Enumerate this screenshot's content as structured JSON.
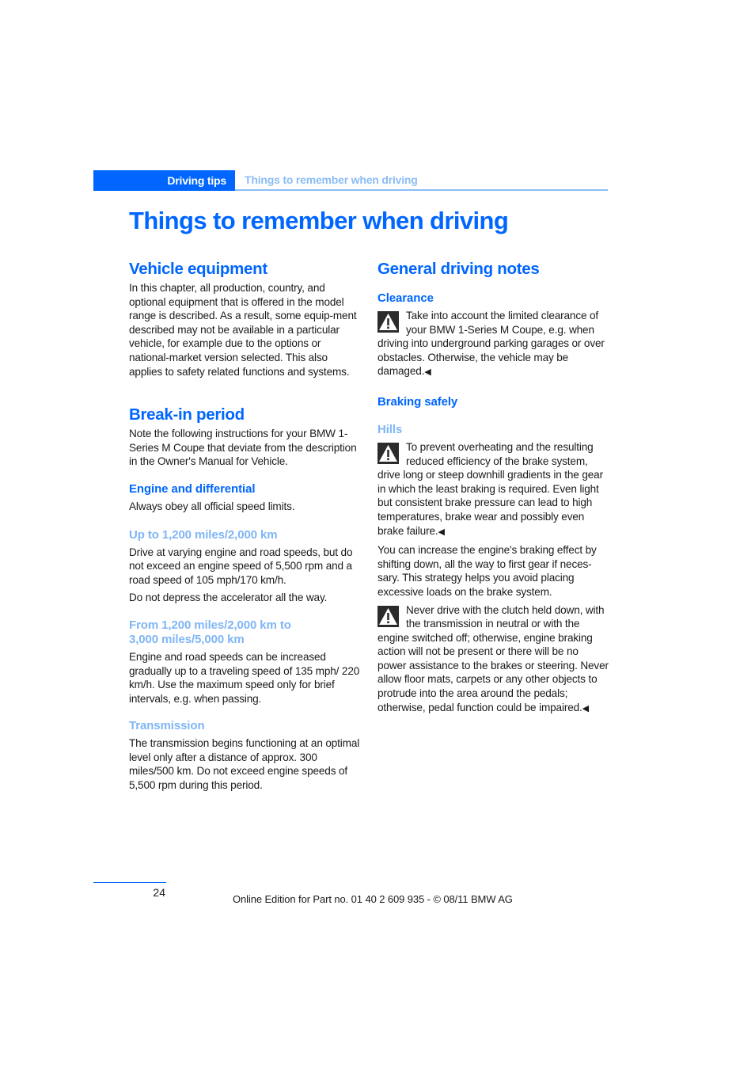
{
  "header": {
    "section": "Driving tips",
    "breadcrumb": "Things to remember when driving"
  },
  "page_title": "Things to remember when driving",
  "left_column": {
    "vehicle_equipment": {
      "heading": "Vehicle equipment",
      "body": "In this chapter, all production, country, and optional equipment that is offered in the model range is described. As a result, some equip-ment described may not be available in a particular vehicle, for example due to the options or national-market version selected. This also applies to safety related functions and systems."
    },
    "break_in": {
      "heading": "Break-in period",
      "body": "Note the following instructions for your BMW 1-Series M Coupe that deviate from the description in the Owner's Manual for Vehicle.",
      "engine": {
        "heading": "Engine and differential",
        "body": "Always obey all official speed limits."
      },
      "up_to": {
        "heading": "Up to 1,200 miles/2,000 km",
        "body1": "Drive at varying engine and road speeds, but do not exceed an engine speed of 5,500 rpm and a road speed of 105 mph/170 km/h.",
        "body2": "Do not depress the accelerator all the way."
      },
      "from": {
        "heading": "From 1,200 miles/2,000 km to 3,000 miles/5,000 km",
        "body": "Engine and road speeds can be increased gradually up to a traveling speed of 135 mph/ 220 km/h. Use the maximum speed only for brief intervals, e.g. when passing."
      },
      "transmission": {
        "heading": "Transmission",
        "body": "The transmission begins functioning at an optimal level only after a distance of approx. 300 miles/500 km. Do not exceed engine speeds of 5,500 rpm during this period."
      }
    }
  },
  "right_column": {
    "heading": "General driving notes",
    "clearance": {
      "heading": "Clearance",
      "warning": "Take into account the limited clearance of your BMW 1-Series M Coupe, e.g. when driving into underground parking garages or over obstacles. Otherwise, the vehicle may be damaged."
    },
    "braking": {
      "heading": "Braking safely",
      "hills": {
        "heading": "Hills",
        "warning": "To prevent overheating and the resulting reduced efficiency of the brake system, drive long or steep downhill gradients in the gear in which the least braking is required. Even light but consistent brake pressure can lead to high temperatures, brake wear and possibly even brake failure.",
        "body": "You can increase the engine's braking effect by shifting down, all the way to first gear if neces-sary. This strategy helps you avoid placing excessive loads on the brake system.",
        "warning2": "Never drive with the clutch held down, with the transmission in neutral or with the engine switched off; otherwise, engine braking action will not be present or there will be no power assistance to the brakes or steering. Never allow floor mats, carpets or any other objects to protrude into the area around the pedals; otherwise, pedal function could be impaired."
      }
    },
    "end_mark": "◀",
    "icon": "warning-triangle-icon"
  },
  "footer": {
    "page_number": "24",
    "edition": "Online Edition for Part no. 01 40 2 609 935 - © 08/11 BMW AG"
  }
}
